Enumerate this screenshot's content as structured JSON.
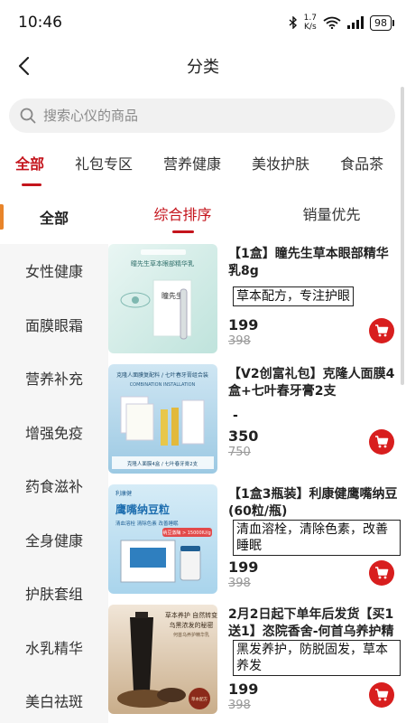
{
  "status": {
    "time": "10:46",
    "speed_value": "1.7",
    "speed_unit": "K/s",
    "battery": "98"
  },
  "header": {
    "title": "分类"
  },
  "search": {
    "placeholder": "搜索心仪的商品"
  },
  "category_tabs": [
    "全部",
    "礼包专区",
    "营养健康",
    "美妆护肤",
    "食品茶"
  ],
  "sidebar": [
    "全部",
    "女性健康",
    "面膜眼霜",
    "营养补充",
    "增强免疫",
    "药食滋补",
    "全身健康",
    "护肤套组",
    "水乳精华",
    "美白祛斑"
  ],
  "sort": [
    "综合排序",
    "销量优先"
  ],
  "products": [
    {
      "title": "【1盒】瞳先生草本眼部精华乳8g",
      "tag": "草本配方，专注护眼",
      "price": "199",
      "old_price": "398",
      "img_text_top": "瞳先生草本眼部精华乳",
      "img_text_box": "瞳先生"
    },
    {
      "title": "【V2创富礼包】克隆人面膜4盒+七叶春牙膏2支",
      "tag": "-",
      "price": "350",
      "old_price": "750",
      "img_text_top": "克隆人面膜复配料 / 七叶春牙膏组合装",
      "img_text_sub": "COMBINATION INSTALLATION",
      "img_text_bottom": "克隆人面膜4盒 / 七叶春牙膏2支"
    },
    {
      "title": "【1盒3瓶装】利康健鹰嘴纳豆(60粒/瓶)",
      "tag": "清血溶栓，清除色素，改善睡眠",
      "price": "199",
      "old_price": "398",
      "img_brand": "利康健",
      "img_title": "鹰嘴纳豆粒",
      "img_points": "清血溶栓 清除色素 改善睡眠",
      "img_badge": "纳豆激酶 > 15000IU/g"
    },
    {
      "title": "2月2日起下单年后发货【买1送1】恣院香舍-何首乌养护精华…",
      "tag": "黑发养护，防脱固发，草本养发",
      "price": "199",
      "old_price": "398",
      "img_line1": "草本养护 自然转变",
      "img_line2": "乌黑浓发的秘密",
      "img_line3": "何首乌养护精华乳",
      "img_seal": "草本配方"
    }
  ],
  "colors": {
    "accent": "#c4141c",
    "cart": "#d81e1e",
    "sidebar_marker": "#e8842a"
  }
}
